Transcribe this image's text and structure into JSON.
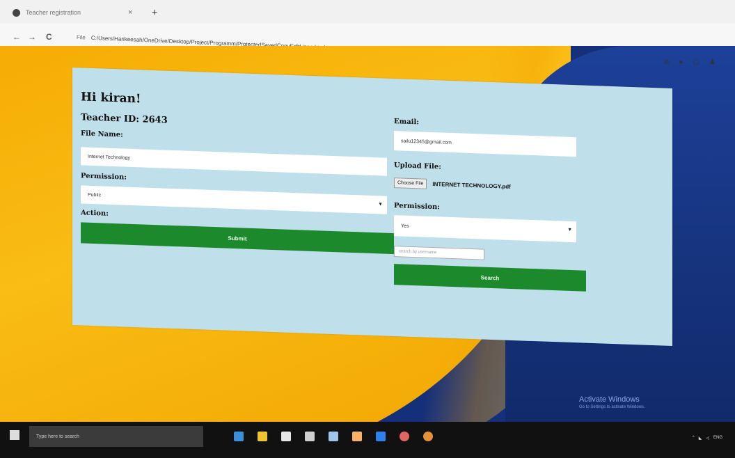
{
  "browser": {
    "tab_title": "Teacher registration",
    "tab_close": "×",
    "new_tab": "+",
    "back": "←",
    "forward": "→",
    "reload": "C",
    "file_label": "File",
    "url": "C:/Users/Harikeesah/OneDrive/Desktop/Project/Programm/ProtectedSavedCopyEditLingo.html",
    "extension_icons": [
      "puzzle-icon",
      "extension-icon",
      "sidebar-icon",
      "profile-icon"
    ]
  },
  "form": {
    "greeting": "Hi kiran!",
    "teacher_id": "Teacher ID: 2643",
    "file_name_label": "File Name:",
    "file_name_value": "Internet Technology",
    "permission_label_left": "Permission:",
    "permission_value_left": "Public",
    "action_label": "Action:",
    "action_button": "Submit",
    "email_label": "Email:",
    "email_value": "sailu12345@gmail.com",
    "upload_label": "Upload File:",
    "choose_file": "Choose File",
    "chosen_file": "INTERNET TECHNOLOGY.pdf",
    "permission_label_right": "Permission:",
    "permission_value_right": "Yes",
    "search_placeholder": "search by username",
    "search_button": "Search"
  },
  "watermark": {
    "title": "Activate Windows",
    "subtitle": "Go to Settings to activate Windows."
  },
  "taskbar": {
    "search_placeholder": "Type here to search",
    "apps": [
      "edge-icon",
      "file-explorer-icon",
      "store-icon",
      "mail-icon",
      "terminal-icon",
      "notepad-icon",
      "vscode-icon",
      "chrome-icon",
      "chrome-icon"
    ],
    "tray_text": "ENG"
  }
}
